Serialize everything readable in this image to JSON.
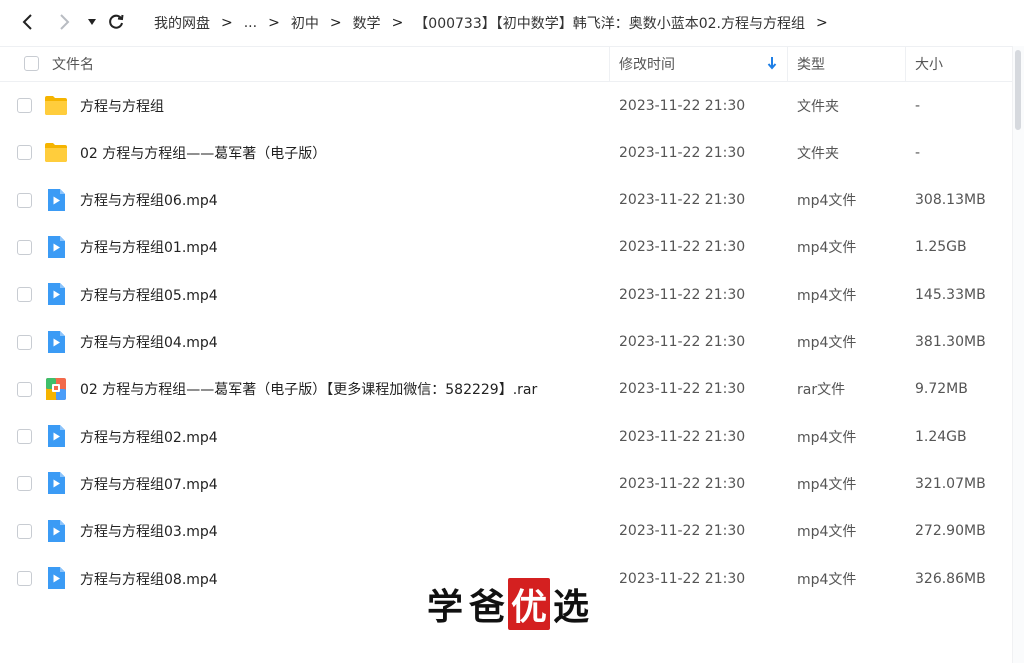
{
  "nav": {
    "back": "back-icon",
    "forward": "forward-icon",
    "dropdown": "caret-down-icon",
    "refresh": "refresh-icon"
  },
  "breadcrumb": [
    {
      "label": "我的网盘"
    },
    {
      "label": "..."
    },
    {
      "label": "初中"
    },
    {
      "label": "数学"
    },
    {
      "label": "【000733】【初中数学】韩飞洋：奥数小蓝本02.方程与方程组"
    }
  ],
  "header": {
    "name": "文件名",
    "modified": "修改时间",
    "type": "类型",
    "size": "大小",
    "sort_icon": "arrow-down-icon",
    "accent": "#1e7fe6"
  },
  "files": [
    {
      "name": "方程与方程组",
      "time": "2023-11-22 21:30",
      "type": "文件夹",
      "size": "-",
      "icon": "folder"
    },
    {
      "name": "02 方程与方程组——葛军著（电子版）",
      "time": "2023-11-22 21:30",
      "type": "文件夹",
      "size": "-",
      "icon": "folder"
    },
    {
      "name": "方程与方程组06.mp4",
      "time": "2023-11-22 21:30",
      "type": "mp4文件",
      "size": "308.13MB",
      "icon": "video"
    },
    {
      "name": "方程与方程组01.mp4",
      "time": "2023-11-22 21:30",
      "type": "mp4文件",
      "size": "1.25GB",
      "icon": "video"
    },
    {
      "name": "方程与方程组05.mp4",
      "time": "2023-11-22 21:30",
      "type": "mp4文件",
      "size": "145.33MB",
      "icon": "video"
    },
    {
      "name": "方程与方程组04.mp4",
      "time": "2023-11-22 21:30",
      "type": "mp4文件",
      "size": "381.30MB",
      "icon": "video"
    },
    {
      "name": "02 方程与方程组——葛军著（电子版）【更多课程加微信：582229】.rar",
      "time": "2023-11-22 21:30",
      "type": "rar文件",
      "size": "9.72MB",
      "icon": "archive"
    },
    {
      "name": "方程与方程组02.mp4",
      "time": "2023-11-22 21:30",
      "type": "mp4文件",
      "size": "1.24GB",
      "icon": "video"
    },
    {
      "name": "方程与方程组07.mp4",
      "time": "2023-11-22 21:30",
      "type": "mp4文件",
      "size": "321.07MB",
      "icon": "video"
    },
    {
      "name": "方程与方程组03.mp4",
      "time": "2023-11-22 21:30",
      "type": "mp4文件",
      "size": "272.90MB",
      "icon": "video"
    },
    {
      "name": "方程与方程组08.mp4",
      "time": "2023-11-22 21:30",
      "type": "mp4文件",
      "size": "326.86MB",
      "icon": "video"
    }
  ],
  "watermark": {
    "chars": [
      "学",
      "爸",
      "优",
      "选"
    ],
    "highlight_color": "#d42020"
  }
}
